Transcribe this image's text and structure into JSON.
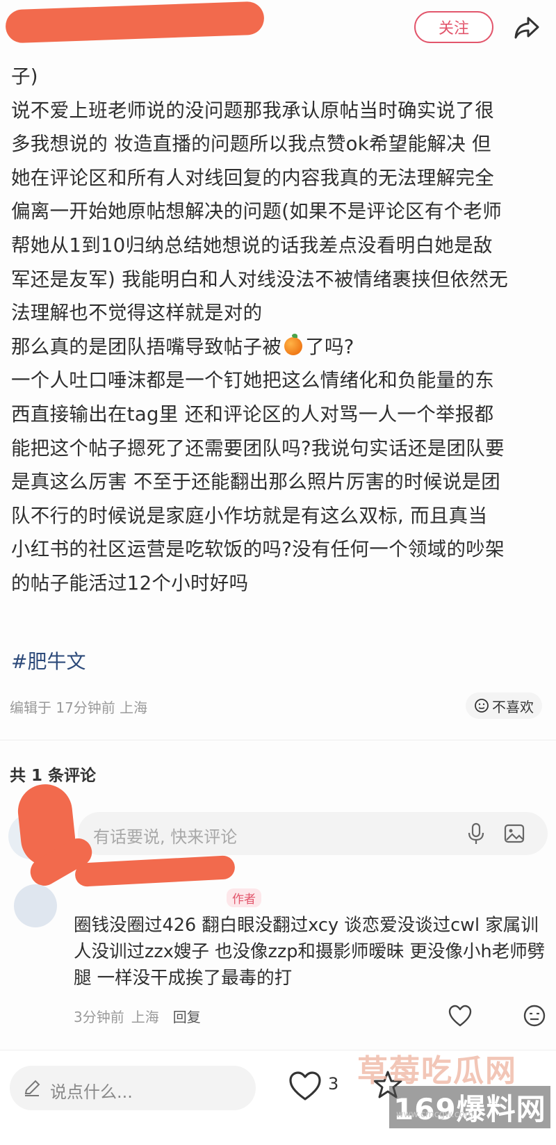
{
  "header": {
    "follow_label": "关注"
  },
  "post": {
    "text_before_emoji": "子)\n说不爱上班老师说的没问题那我承认原帖当时确实说了很\n多我想说的 妆造直播的问题所以我点赞ok希望能解决 但\n她在评论区和所有人对线回复的内容我真的无法理解完全\n偏离一开始她原帖想解决的问题(如果不是评论区有个老师\n帮她从1到10归纳总结她想说的话我差点没看明白她是敌\n军还是友军) 我能明白和人对线没法不被情绪裹挟但依然无\n法理解也不觉得这样就是对的\n那么真的是团队捂嘴导致帖子被",
    "emoji": "orange-emoji",
    "text_after_emoji": "了吗?\n一个人吐口唾沫都是一个钉她把这么情绪化和负能量的东\n西直接输出在tag里 还和评论区的人对骂一人一个举报都\n能把这个帖子摁死了还需要团队吗?我说句实话还是团队要\n是真这么厉害 不至于还能翻出那么照片厉害的时候说是团\n队不行的时候说是家庭小作坊就是有这么双标, 而且真当\n小红书的社区运营是吃软饭的吗?没有任何一个领域的吵架\n的帖子能活过12个小时好吗",
    "hashtag": "#肥牛文",
    "meta": "编辑于 17分钟前 上海",
    "dislike_label": "不喜欢"
  },
  "comments": {
    "count_label": "共 1 条评论",
    "input_placeholder": "有话要说, 快来评论",
    "reply": {
      "author_tag": "作者",
      "text": "圈钱没圈过426 翻白眼没翻过xcy 谈恋爱没谈过cwl 家属训人没训过zzx嫂子 也没像zzp和摄影师暧昧 更没像小h老师劈腿 一样没干成挨了最毒的打",
      "time": "3分钟前",
      "location": "上海",
      "reply_label": "回复"
    }
  },
  "bottom_bar": {
    "input_placeholder": "说点什么...",
    "like_count": "3"
  },
  "watermark": {
    "line1": "草莓吃瓜网",
    "line2": "169爆料网",
    "url": "www.cmcgw.com"
  },
  "colors": {
    "accent": "#e2566c",
    "redaction": "#f26a4d",
    "hashtag": "#2d4a7a"
  }
}
